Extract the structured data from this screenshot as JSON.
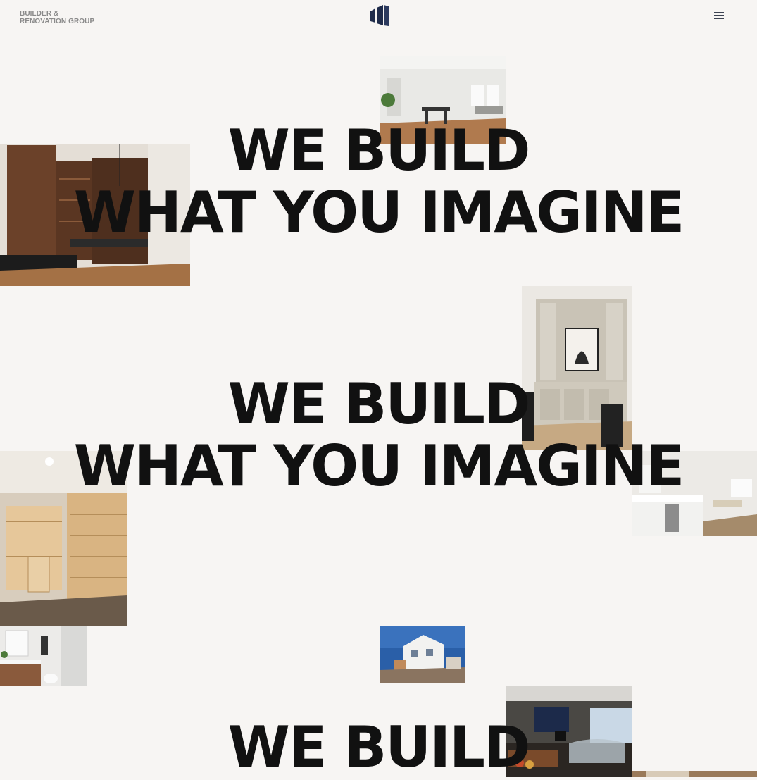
{
  "header": {
    "brand_line1": "BUILDER &",
    "brand_line2": "RENOVATION GROUP",
    "logo_icon": "building-logo-icon",
    "menu_icon": "hamburger-menu-icon"
  },
  "headlines": [
    {
      "line1": "WE BUILD",
      "line2": "WHAT YOU IMAGINE"
    },
    {
      "line1": "WE BUILD",
      "line2": "WHAT YOU IMAGINE"
    },
    {
      "line1": "WE BUILD"
    }
  ],
  "colors": {
    "background": "#f7f5f3",
    "headline": "#111111",
    "logo": "#1f2b4a",
    "brand_text": "#8a8a8a"
  }
}
